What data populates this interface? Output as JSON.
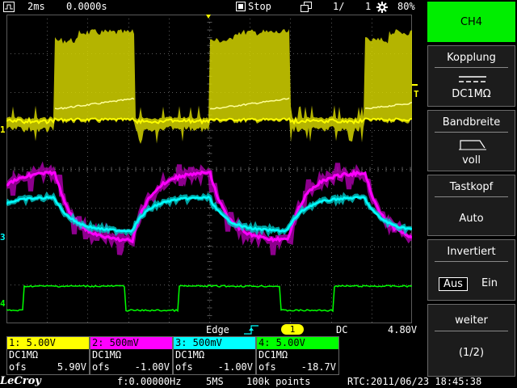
{
  "topbar": {
    "timebase": "2ms",
    "delay": "0.0000s",
    "run_state": "Stop",
    "memory_page": "1/",
    "memory_count": "1",
    "battery": "80%"
  },
  "side_menu": {
    "channel": "CH4",
    "coupling_title": "Kopplung",
    "coupling_value": "DC1MΩ",
    "bandwidth_title": "Bandbreite",
    "bandwidth_value": "voll",
    "probe_title": "Tastkopf",
    "probe_value": "Auto",
    "invert_title": "Invertiert",
    "invert_off": "Aus",
    "invert_on": "Ein",
    "more_title": "weiter",
    "more_page": "(1/2)"
  },
  "trigger": {
    "type": "Edge",
    "source": "1",
    "coupling": "DC",
    "level": "4.80V"
  },
  "channels": [
    {
      "label": "1: 5.00V",
      "coupling": "DC1MΩ",
      "ofs_label": "ofs",
      "ofs_value": "5.90V",
      "color": "#ffff00"
    },
    {
      "label": "2: 500mV",
      "coupling": "DC1MΩ",
      "ofs_label": "ofs",
      "ofs_value": "-1.00V",
      "color": "#ff00ff"
    },
    {
      "label": "3: 500mV",
      "coupling": "DC1MΩ",
      "ofs_label": "ofs",
      "ofs_value": "-1.00V",
      "color": "#00ffff"
    },
    {
      "label": "4: 5.00V",
      "coupling": "DC1MΩ",
      "ofs_label": "ofs",
      "ofs_value": "-18.7V",
      "color": "#00ff00"
    }
  ],
  "statusbar": {
    "brand": "LeCroy",
    "frequency": "f:0.00000Hz",
    "sample_rate": "5MS",
    "points": "100k points",
    "rtc": "RTC:2011/06/23 18:45:38"
  },
  "markers": {
    "ch1": "1",
    "ch3": "3",
    "ch4": "4",
    "trigger_level": "T"
  },
  "colors": {
    "ch1": "#ffff00",
    "ch2": "#ff00ff",
    "ch3": "#00ffff",
    "ch4": "#00ff00",
    "active_menu": "#00ff00",
    "grid": "#5a5a5a"
  }
}
